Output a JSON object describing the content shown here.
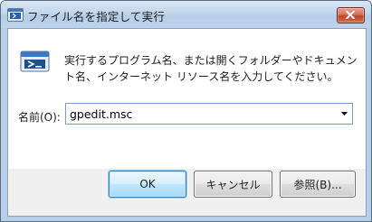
{
  "window": {
    "title": "ファイル名を指定して実行",
    "close_icon": "close-icon"
  },
  "dialog": {
    "description": "実行するプログラム名、または開くフォルダーやドキュメント名、インターネット リソース名を入力してください。",
    "open_label": "名前(O):",
    "open_value": "gpedit.msc"
  },
  "buttons": {
    "ok": "OK",
    "cancel": "キャンセル",
    "browse": "参照(B)..."
  }
}
